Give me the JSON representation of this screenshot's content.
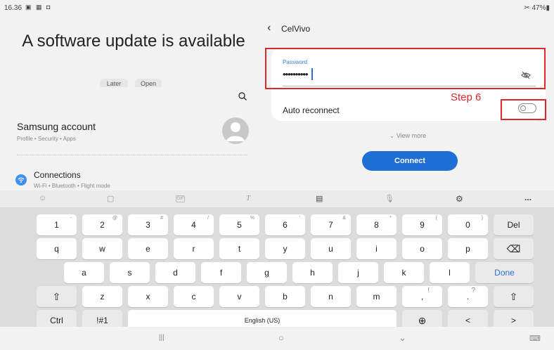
{
  "status": {
    "time": "16.36",
    "icons": "▣ ▦ ◘",
    "right": "✂ 47%▮"
  },
  "update": {
    "title": "A software update is available",
    "later": "Later",
    "open": "Open"
  },
  "settings": {
    "samsung_account": {
      "title": "Samsung account",
      "subtitle": "Profile • Security • Apps"
    },
    "connections": {
      "title": "Connections",
      "subtitle": "Wi-Fi • Bluetooth • Flight mode"
    }
  },
  "wifi": {
    "network": "CelVivo",
    "password_label": "Password",
    "password_value": "••••••••••",
    "auto_reconnect": "Auto reconnect",
    "auto_reconnect_on": false,
    "view_more": "⌄ View more",
    "connect": "Connect"
  },
  "annotation": {
    "step": "Step 6",
    "color": "#e0262b"
  },
  "keyboard": {
    "toolbar": {
      "emoji": "☺",
      "sticker": "▢",
      "gif": "GIF",
      "handwriting": "T",
      "clipboard": "▤",
      "mic": "🎙",
      "settings": "⚙",
      "more": "..."
    },
    "row1": [
      {
        "label": "1",
        "alt": "-"
      },
      {
        "label": "2",
        "alt": "@"
      },
      {
        "label": "3",
        "alt": "#"
      },
      {
        "label": "4",
        "alt": "/"
      },
      {
        "label": "5",
        "alt": "%"
      },
      {
        "label": "6",
        "alt": "'"
      },
      {
        "label": "7",
        "alt": "&"
      },
      {
        "label": "8",
        "alt": "*"
      },
      {
        "label": "9",
        "alt": "("
      },
      {
        "label": "0",
        "alt": ")"
      }
    ],
    "del": "Del",
    "row2": [
      "q",
      "w",
      "e",
      "r",
      "t",
      "y",
      "u",
      "i",
      "o",
      "p"
    ],
    "backspace": "⌫",
    "row3": [
      "a",
      "s",
      "d",
      "f",
      "g",
      "h",
      "j",
      "k",
      "l"
    ],
    "done": "Done",
    "shift": "⇧",
    "row4": [
      "z",
      "x",
      "c",
      "v",
      "b",
      "n",
      "m"
    ],
    "comma": ",",
    "comma_alt": "!",
    "period": ".",
    "period_alt": "?",
    "ctrl": "Ctrl",
    "symbols": "!#1",
    "space": "English (US)",
    "globe": "⊕",
    "left": "<",
    "right": ">"
  },
  "nav": {
    "recents": "|||",
    "home": "○",
    "back": "⌄",
    "keyboard_switch": "⌨"
  }
}
